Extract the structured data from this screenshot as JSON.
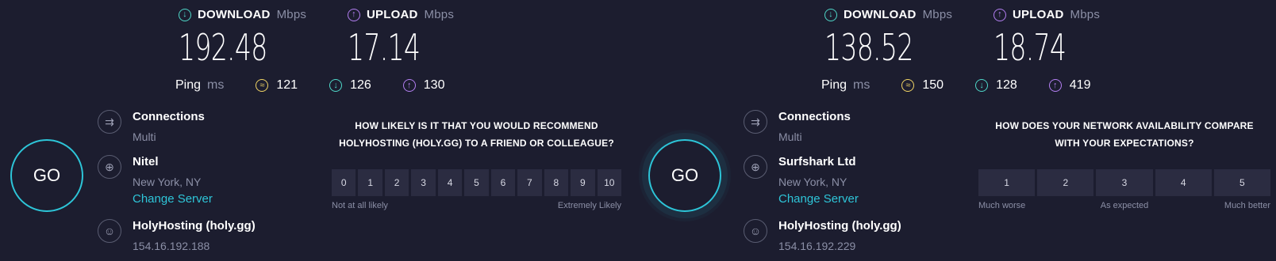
{
  "panels": [
    {
      "download": {
        "label": "DOWNLOAD",
        "unit": "Mbps",
        "value": "192.48"
      },
      "upload": {
        "label": "UPLOAD",
        "unit": "Mbps",
        "value": "17.14"
      },
      "ping": {
        "label": "Ping",
        "unit": "ms",
        "idle": "121",
        "download": "126",
        "upload": "130"
      },
      "go_label": "GO",
      "connections": {
        "title": "Connections",
        "value": "Multi"
      },
      "server": {
        "title": "Nitel",
        "location": "New York, NY",
        "change_link": "Change Server"
      },
      "host": {
        "title": "HolyHosting (holy.gg)",
        "ip": "154.16.192.188"
      },
      "survey": {
        "line1": "HOW LIKELY IS IT THAT YOU WOULD RECOMMEND",
        "line2": "HOLYHOSTING (HOLY.GG) TO A FRIEND OR COLLEAGUE?",
        "options": [
          "0",
          "1",
          "2",
          "3",
          "4",
          "5",
          "6",
          "7",
          "8",
          "9",
          "10"
        ],
        "low_label": "Not at all likely",
        "high_label": "Extremely Likely"
      }
    },
    {
      "download": {
        "label": "DOWNLOAD",
        "unit": "Mbps",
        "value": "138.52"
      },
      "upload": {
        "label": "UPLOAD",
        "unit": "Mbps",
        "value": "18.74"
      },
      "ping": {
        "label": "Ping",
        "unit": "ms",
        "idle": "150",
        "download": "128",
        "upload": "419"
      },
      "go_label": "GO",
      "connections": {
        "title": "Connections",
        "value": "Multi"
      },
      "server": {
        "title": "Surfshark Ltd",
        "location": "New York, NY",
        "change_link": "Change Server"
      },
      "host": {
        "title": "HolyHosting (holy.gg)",
        "ip": "154.16.192.229"
      },
      "survey": {
        "line1": "HOW DOES YOUR NETWORK AVAILABILITY COMPARE",
        "line2": "WITH YOUR EXPECTATIONS?",
        "options": [
          "1",
          "2",
          "3",
          "4",
          "5"
        ],
        "low_label": "Much worse",
        "mid_label": "As expected",
        "high_label": "Much better"
      }
    }
  ],
  "colors": {
    "background": "#1c1d2f",
    "accent": "#2ec5d8",
    "download": "#4fd8c9",
    "upload": "#b37ff2",
    "ping": "#f2d565"
  }
}
